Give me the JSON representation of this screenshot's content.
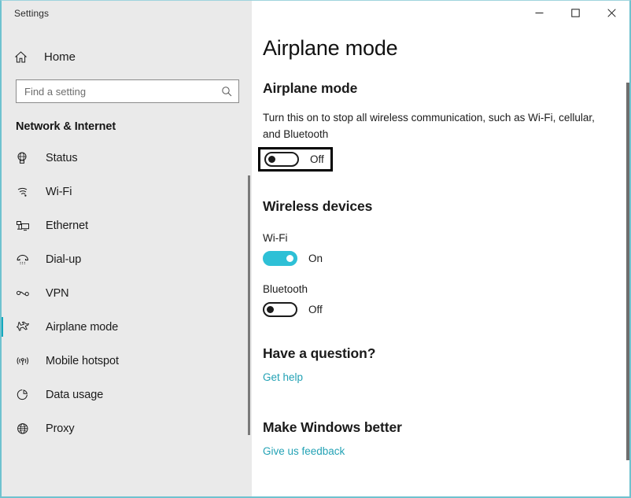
{
  "window": {
    "title": "Settings",
    "accent_color": "#2ec0d6",
    "border_color": "#6fc2cf",
    "controls": {
      "minimize": "minimize-button",
      "maximize": "maximize-button",
      "close": "close-button"
    }
  },
  "sidebar": {
    "home_label": "Home",
    "search": {
      "placeholder": "Find a setting",
      "value": ""
    },
    "section_title": "Network & Internet",
    "items": [
      {
        "label": "Status",
        "icon": "globe-monitor-icon",
        "selected": false
      },
      {
        "label": "Wi-Fi",
        "icon": "wifi-icon",
        "selected": false
      },
      {
        "label": "Ethernet",
        "icon": "ethernet-icon",
        "selected": false
      },
      {
        "label": "Dial-up",
        "icon": "dialup-phone-icon",
        "selected": false
      },
      {
        "label": "VPN",
        "icon": "vpn-icon",
        "selected": false
      },
      {
        "label": "Airplane mode",
        "icon": "airplane-icon",
        "selected": true
      },
      {
        "label": "Mobile hotspot",
        "icon": "hotspot-icon",
        "selected": false
      },
      {
        "label": "Data usage",
        "icon": "pie-chart-icon",
        "selected": false
      },
      {
        "label": "Proxy",
        "icon": "globe-icon",
        "selected": false
      }
    ]
  },
  "main": {
    "page_title": "Airplane mode",
    "airplane": {
      "heading": "Airplane mode",
      "description": "Turn this on to stop all wireless communication, such as Wi-Fi, cellular, and Bluetooth",
      "toggle_state": "Off",
      "toggle_on": false,
      "focused": true
    },
    "wireless_devices": {
      "heading": "Wireless devices",
      "devices": [
        {
          "label": "Wi-Fi",
          "state": "On",
          "on": true
        },
        {
          "label": "Bluetooth",
          "state": "Off",
          "on": false
        }
      ]
    },
    "help": {
      "heading": "Have a question?",
      "link": "Get help"
    },
    "feedback": {
      "heading": "Make Windows better",
      "link": "Give us feedback"
    }
  }
}
